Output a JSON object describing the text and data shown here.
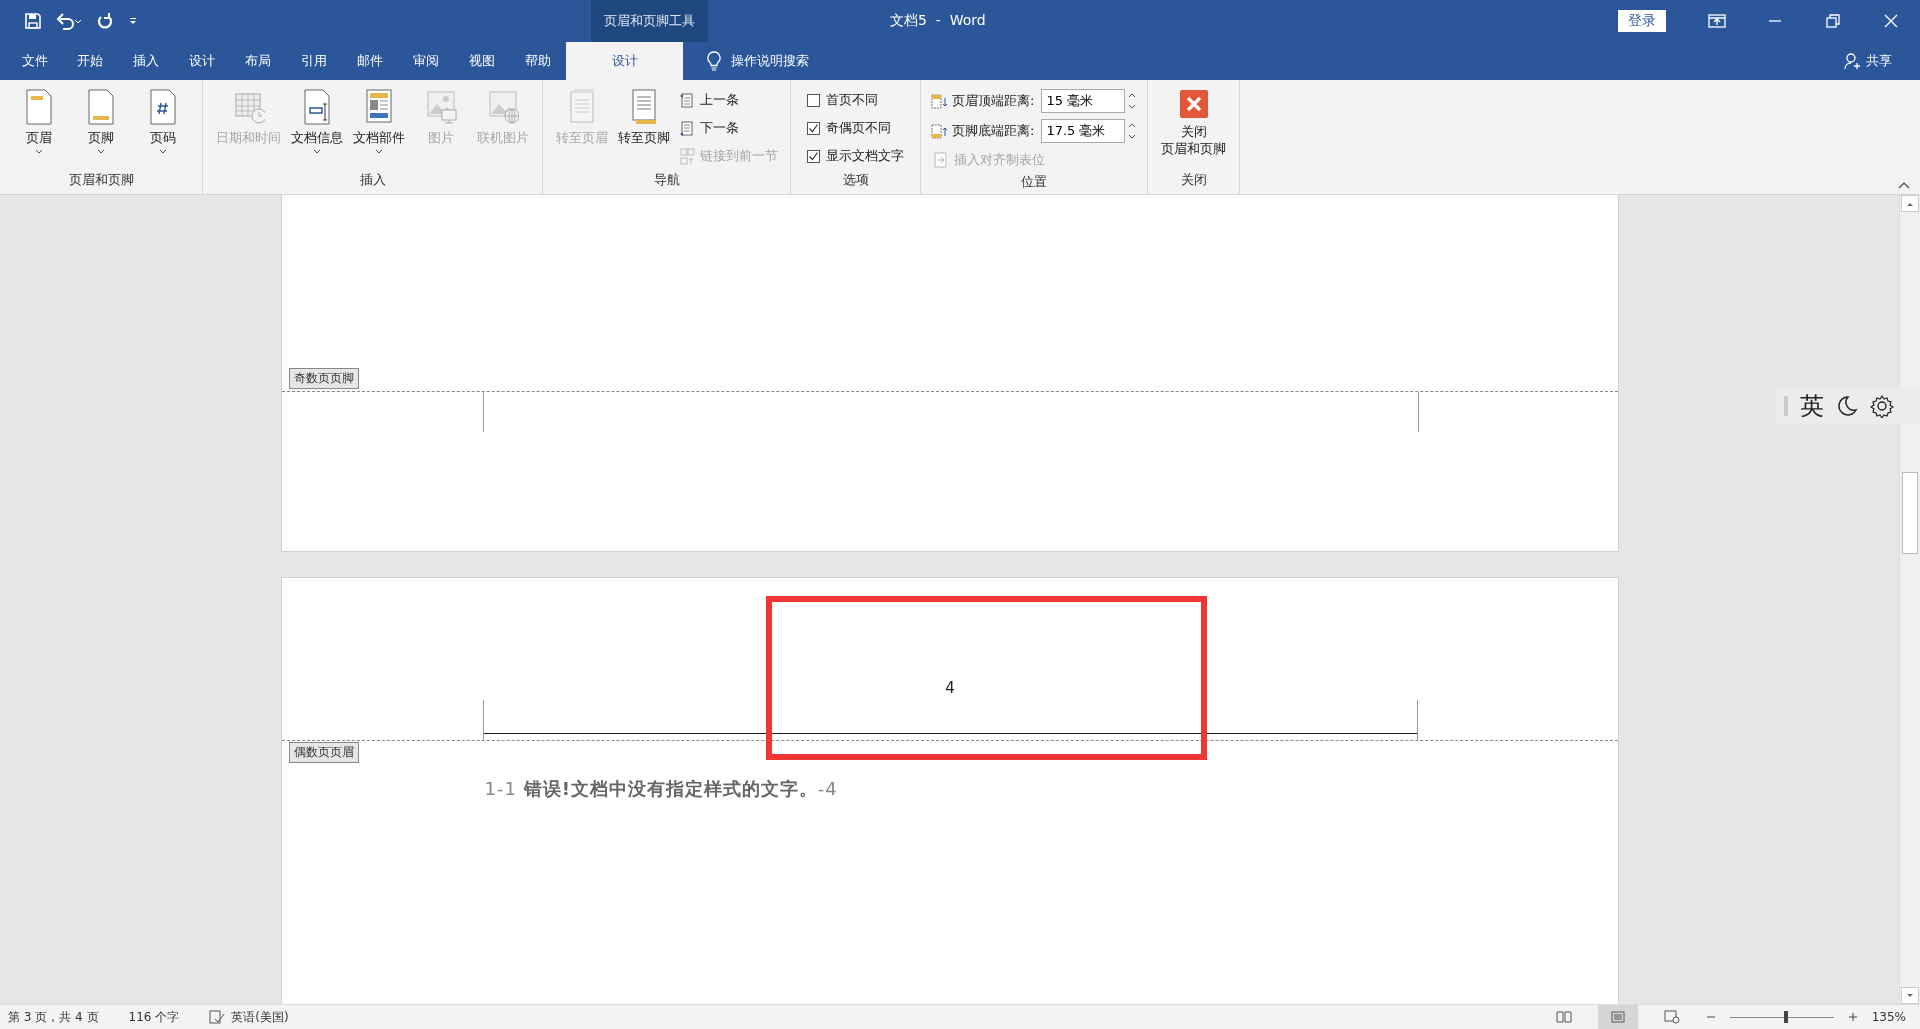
{
  "title_bar": {
    "contextual_group": "页眉和页脚工具",
    "title": "文档5  -  Word",
    "sign_in": "登录"
  },
  "tabs": [
    {
      "label": "文件",
      "selected": false
    },
    {
      "label": "开始",
      "selected": false
    },
    {
      "label": "插入",
      "selected": false
    },
    {
      "label": "设计",
      "selected": false
    },
    {
      "label": "布局",
      "selected": false
    },
    {
      "label": "引用",
      "selected": false
    },
    {
      "label": "邮件",
      "selected": false
    },
    {
      "label": "审阅",
      "selected": false
    },
    {
      "label": "视图",
      "selected": false
    },
    {
      "label": "帮助",
      "selected": false
    },
    {
      "label": "设计",
      "selected": true
    }
  ],
  "tell_me": "操作说明搜索",
  "share": "共享",
  "ribbon": [
    {
      "label": "页眉和页脚",
      "items": [
        {
          "kind": "large",
          "label": "页眉",
          "disabled": false,
          "dropdown": true
        },
        {
          "kind": "large",
          "label": "页脚",
          "disabled": false,
          "dropdown": true
        },
        {
          "kind": "large",
          "label": "页码",
          "disabled": false,
          "dropdown": true
        }
      ]
    },
    {
      "label": "插入",
      "items": [
        {
          "kind": "large",
          "label": "日期和时间",
          "disabled": true,
          "dropdown": false
        },
        {
          "kind": "large",
          "label": "文档信息",
          "disabled": false,
          "dropdown": true
        },
        {
          "kind": "large",
          "label": "文档部件",
          "disabled": false,
          "dropdown": true
        },
        {
          "kind": "large",
          "label": "图片",
          "disabled": true,
          "dropdown": false
        },
        {
          "kind": "large",
          "label": "联机图片",
          "disabled": true,
          "dropdown": false
        }
      ]
    },
    {
      "label": "导航",
      "items": [
        {
          "kind": "large",
          "label": "转至页眉",
          "disabled": true,
          "dropdown": false
        },
        {
          "kind": "large",
          "label": "转至页脚",
          "disabled": false,
          "dropdown": false
        },
        {
          "kind": "stack",
          "items": [
            {
              "kind": "small",
              "label": "上一条",
              "disabled": false
            },
            {
              "kind": "small",
              "label": "下一条",
              "disabled": false
            },
            {
              "kind": "small",
              "label": "链接到前一节",
              "disabled": true
            }
          ]
        }
      ]
    },
    {
      "label": "选项",
      "items": [
        {
          "kind": "stack",
          "items": [
            {
              "kind": "checkbox",
              "label": "首页不同",
              "checked": false
            },
            {
              "kind": "checkbox",
              "label": "奇偶页不同",
              "checked": true
            },
            {
              "kind": "checkbox",
              "label": "显示文档文字",
              "checked": true
            }
          ]
        }
      ]
    },
    {
      "label": "位置",
      "items": [
        {
          "kind": "stack",
          "items": [
            {
              "kind": "spin",
              "label": "页眉顶端距离:",
              "value": "15 毫米"
            },
            {
              "kind": "spin",
              "label": "页脚底端距离:",
              "value": "17.5 毫米"
            },
            {
              "kind": "small",
              "label": "插入对齐制表位",
              "disabled": true
            }
          ]
        }
      ]
    },
    {
      "label": "关闭",
      "items": [
        {
          "kind": "close",
          "lines": [
            "关闭",
            "页眉和页脚"
          ]
        }
      ]
    }
  ],
  "pages": [
    {
      "footer_tag": "奇数页页脚"
    },
    {
      "header_text": "4",
      "header_tag": "偶数页页眉",
      "body_text": "1-1 **错误!文档中没有指定样式的文字。**-4"
    }
  ],
  "ime_bar": {
    "language": "英"
  },
  "status_bar": {
    "items": [
      "第 3 页，共 4 页",
      "116 个字",
      "英语(美国)"
    ],
    "zoom": {
      "level": 0.54,
      "reading": "135%"
    }
  }
}
